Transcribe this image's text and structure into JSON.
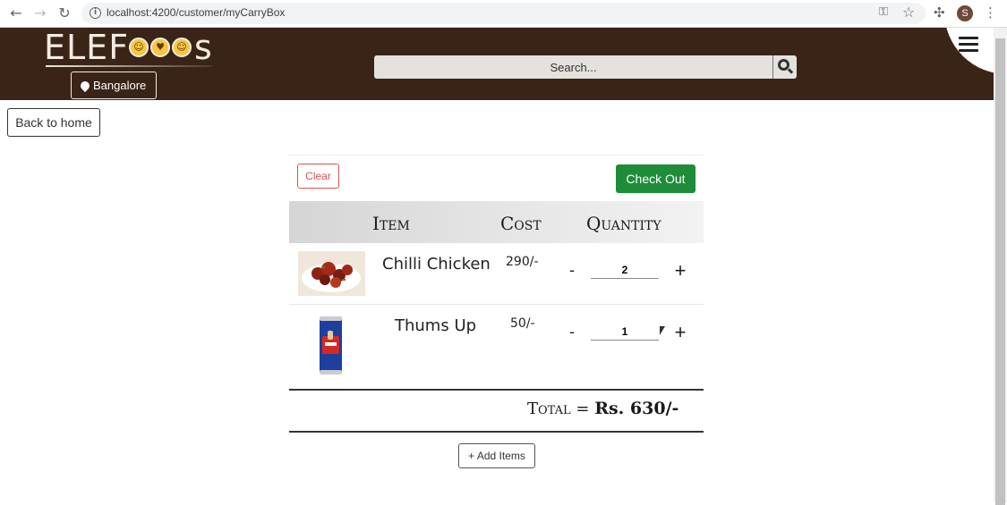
{
  "browser": {
    "url": "localhost:4200/customer/myCarryBox",
    "profile_initial": "S"
  },
  "header": {
    "logo": "ELEFoods",
    "location": "Bangalore",
    "search_placeholder": "Search..."
  },
  "page": {
    "back_label": "Back to home",
    "clear_label": "Clear",
    "checkout_label": "Check Out",
    "columns": [
      "Item",
      "Cost",
      "Quantity"
    ],
    "items": [
      {
        "name": "Chilli Chicken",
        "cost": "290/-",
        "quantity": "2"
      },
      {
        "name": "Thums Up",
        "cost": "50/-",
        "quantity": "1"
      }
    ],
    "qty_minus": "-",
    "qty_plus": "+",
    "total_label": "Total =",
    "total_amount": "Rs. 630/-",
    "add_items_label": "+ Add Items"
  },
  "colors": {
    "header_bg": "#3a2418",
    "checkout_green": "#1f8c3a",
    "clear_red": "#d9534f"
  }
}
